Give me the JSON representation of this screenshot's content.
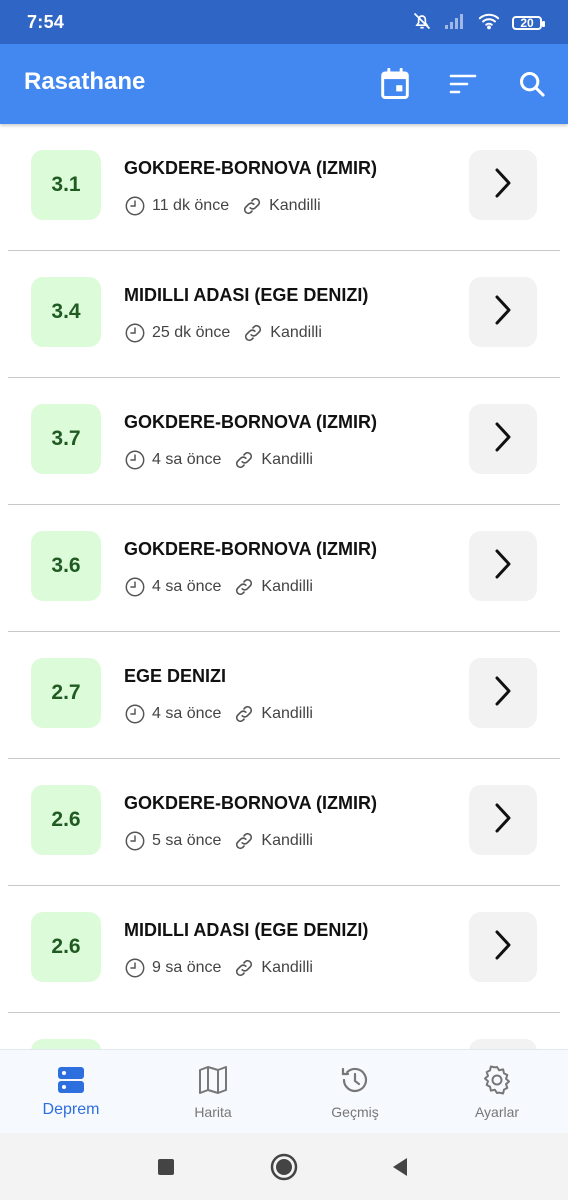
{
  "status_bar": {
    "time": "7:54",
    "battery": "20"
  },
  "app_bar": {
    "title": "Rasathane",
    "actions": [
      "calendar-icon",
      "sort-icon",
      "search-icon"
    ]
  },
  "quakes": [
    {
      "magnitude": "3.1",
      "place": "GOKDERE-BORNOVA (IZMIR)",
      "time_ago": "11 dk önce",
      "source": "Kandilli"
    },
    {
      "magnitude": "3.4",
      "place": "MIDILLI ADASI (EGE DENIZI)",
      "time_ago": "25 dk önce",
      "source": "Kandilli"
    },
    {
      "magnitude": "3.7",
      "place": "GOKDERE-BORNOVA (IZMIR)",
      "time_ago": "4 sa önce",
      "source": "Kandilli"
    },
    {
      "magnitude": "3.6",
      "place": "GOKDERE-BORNOVA (IZMIR)",
      "time_ago": "4 sa önce",
      "source": "Kandilli"
    },
    {
      "magnitude": "2.7",
      "place": "EGE DENIZI",
      "time_ago": "4 sa önce",
      "source": "Kandilli"
    },
    {
      "magnitude": "2.6",
      "place": "GOKDERE-BORNOVA (IZMIR)",
      "time_ago": "5 sa önce",
      "source": "Kandilli"
    },
    {
      "magnitude": "2.6",
      "place": "MIDILLI ADASI (EGE DENIZI)",
      "time_ago": "9 sa önce",
      "source": "Kandilli"
    },
    {
      "magnitude": "",
      "place": "",
      "time_ago": "",
      "source": ""
    }
  ],
  "bottom_nav": [
    {
      "label": "Deprem",
      "icon": "server-list-icon",
      "active": true
    },
    {
      "label": "Harita",
      "icon": "map-icon",
      "active": false
    },
    {
      "label": "Geçmiş",
      "icon": "history-icon",
      "active": false
    },
    {
      "label": "Ayarlar",
      "icon": "gear-icon",
      "active": false
    }
  ],
  "colors": {
    "app_bar": "#4288f0",
    "status_bar": "#2f66c6",
    "magnitude_bg": "#dcfbd8",
    "magnitude_text": "#1f5b22",
    "nav_active": "#2e6fe0"
  }
}
